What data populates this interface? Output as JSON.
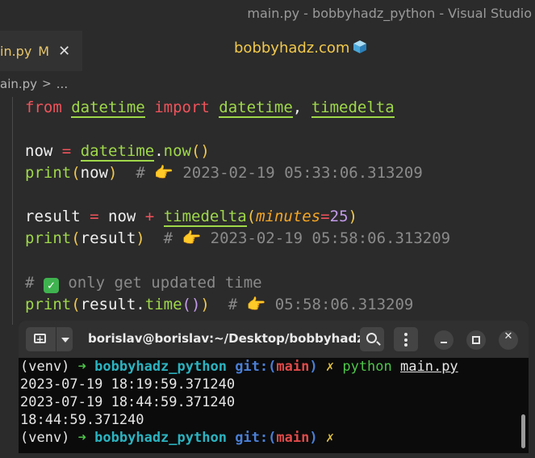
{
  "window": {
    "title": "main.py - bobbyhadz_python - Visual Studio"
  },
  "tab": {
    "name": "in.py",
    "status": "M",
    "close_icon": "close-icon"
  },
  "header": {
    "site": "bobbyhadz.com",
    "site_icon": "cube-icon"
  },
  "breadcrumb": {
    "file": "ain.py",
    "separator": ">",
    "more": "..."
  },
  "code": {
    "line1": {
      "from": "from",
      "module": "datetime",
      "import": "import",
      "name1": "datetime",
      "comma": ",",
      "name2": "timedelta"
    },
    "line3": {
      "var": "now",
      "eq": "=",
      "cls": "datetime",
      "dot": ".",
      "method": "now",
      "parens": "()"
    },
    "line4": {
      "print": "print",
      "open": "(",
      "arg": "now",
      "close": ")",
      "hash": "#",
      "comment": "2023-02-19 05:33:06.313209"
    },
    "line6": {
      "var": "result",
      "eq": "=",
      "now": "now",
      "plus": "+",
      "fn": "timedelta",
      "open": "(",
      "param": "minutes",
      "peq": "=",
      "num": "25",
      "close": ")"
    },
    "line7": {
      "print": "print",
      "open": "(",
      "arg": "result",
      "close": ")",
      "hash": "#",
      "comment": "2023-02-19 05:58:06.313209"
    },
    "line9": {
      "hash": "#",
      "comment": "only get updated time"
    },
    "line10": {
      "print": "print",
      "open": "(",
      "arg": "result",
      "dot": ".",
      "method": "time",
      "parens": "()",
      "close": ")",
      "hash": "#",
      "comment": "05:58:06.313209"
    }
  },
  "terminal": {
    "title": "borislav@borislav:~/Desktop/bobbyhadz_...",
    "lines": [
      {
        "venv": "(venv)",
        "arrow": "➜",
        "dir": "bobbyhadz_python",
        "git": "git:",
        "open": "(",
        "branch": "main",
        "close": ")",
        "x": "✗",
        "cmd": "python",
        "arg": "main.py"
      },
      {
        "text": "2023-07-19 18:19:59.371240"
      },
      {
        "text": "2023-07-19 18:44:59.371240"
      },
      {
        "text": "18:44:59.371240"
      },
      {
        "venv": "(venv)",
        "arrow": "➜",
        "dir": "bobbyhadz_python",
        "git": "git:",
        "open": "(",
        "branch": "main",
        "close": ")",
        "x": "✗"
      }
    ]
  },
  "colors": {
    "keyword": "#f0535b",
    "function": "#9fd84a",
    "number": "#c39bea",
    "param": "#f5a623",
    "comment": "#8a8a8a",
    "site_title": "#f2c94c",
    "terminal_bg": "#0b0b0b"
  }
}
